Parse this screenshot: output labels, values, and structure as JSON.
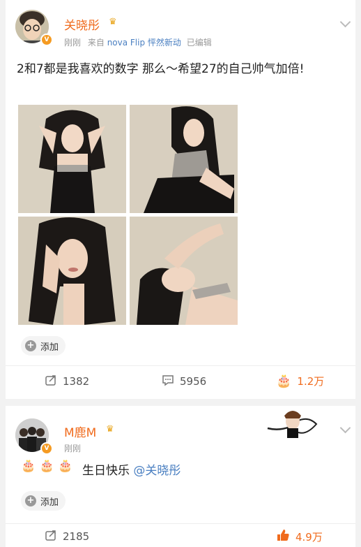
{
  "post1": {
    "author": "关晓彤",
    "time": "刚刚",
    "source_prefix": "来自",
    "source": "nova Flip 怦然新动",
    "edited": "已编辑",
    "text": "2和7都是我喜欢的数字 那么～希望27的自己帅气加倍!",
    "add_label": "添加",
    "repost_count": "1382",
    "comment_count": "5956",
    "like_count": "1.2万"
  },
  "post2": {
    "author": "M鹿M",
    "time": "刚刚",
    "cakes": "🎂 🎂 🎂",
    "text": "生日快乐",
    "mention": "@关晓彤",
    "add_label": "添加",
    "repost_count": "2185",
    "like_count": "4.9万"
  },
  "colors": {
    "accent": "#f06b1d",
    "link": "#4a7fc1"
  },
  "icons": [
    "crown-icon",
    "verified-icon",
    "chevron-down-icon",
    "repost-icon",
    "comment-icon",
    "like-icon",
    "add-icon"
  ]
}
